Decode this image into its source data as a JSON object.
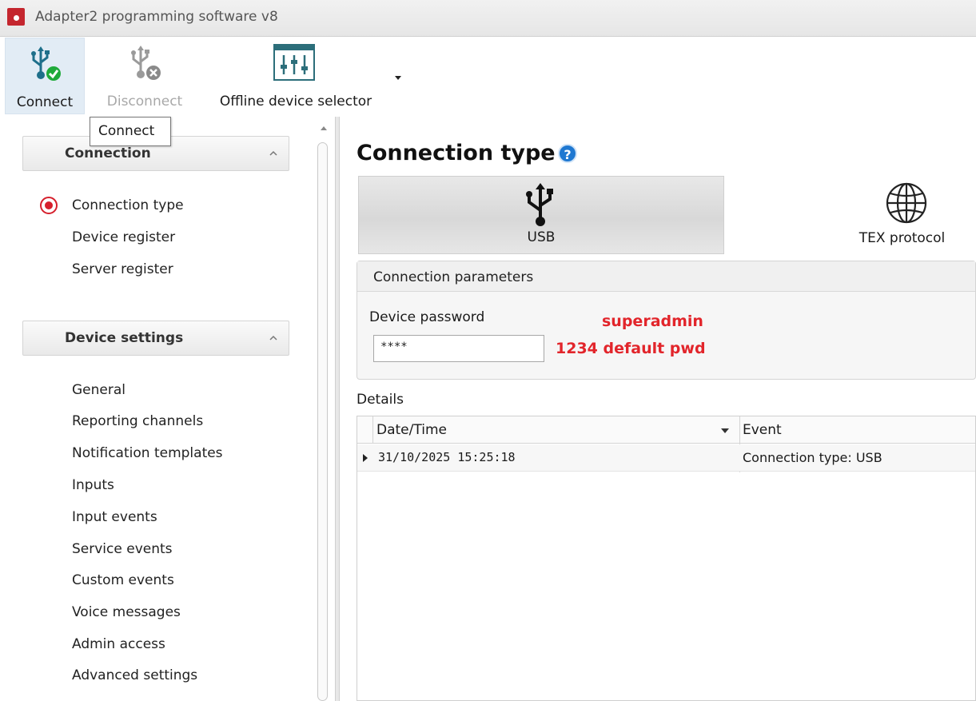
{
  "window": {
    "title": "Adapter2 programming software v8"
  },
  "toolbar": {
    "connect_label": "Connect",
    "disconnect_label": "Disconnect",
    "offline_label": "Offline device selector"
  },
  "tooltip": {
    "text": "Connect"
  },
  "sidebar": {
    "connection_header": "Connection",
    "connection_items": [
      "Connection type",
      "Device register",
      "Server register"
    ],
    "device_header": "Device settings",
    "device_items": [
      "General",
      "Reporting channels",
      "Notification templates",
      "Inputs",
      "Input events",
      "Service events",
      "Custom events",
      "Voice messages",
      "Admin access",
      "Advanced settings"
    ]
  },
  "main": {
    "title": "Connection type",
    "tiles": {
      "usb": "USB",
      "tex": "TEX protocol"
    },
    "params_header": "Connection parameters",
    "password_label": "Device password",
    "password_value": "****",
    "annotation_line1": "superadmin",
    "annotation_line2": "1234 default pwd",
    "details_label": "Details",
    "grid": {
      "columns": [
        "Date/Time",
        "Event"
      ],
      "rows": [
        {
          "datetime": "31/10/2025 15:25:18",
          "event": "Connection type: USB"
        }
      ]
    }
  },
  "colors": {
    "accent_red": "#e2252b",
    "help_blue": "#1f78d1",
    "connect_green": "#1faa3a"
  }
}
